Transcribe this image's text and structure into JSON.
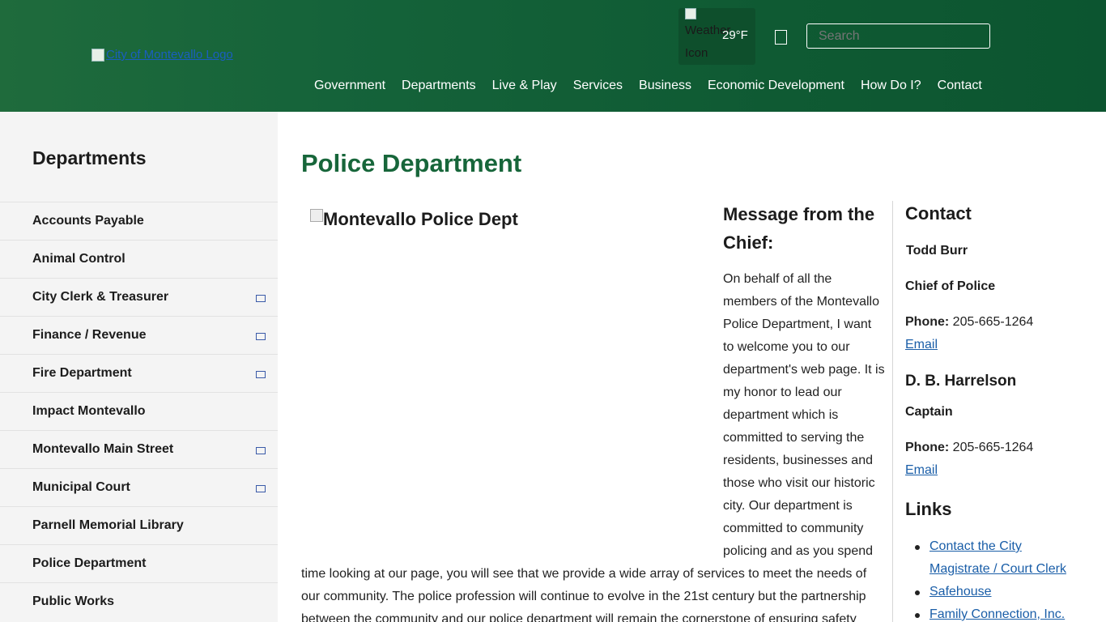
{
  "header": {
    "logo_alt": "City of Montevallo Logo",
    "weather_icon_alt": "Weather Icon",
    "temperature": "29°F",
    "search_placeholder": "Search"
  },
  "nav": [
    "Government",
    "Departments",
    "Live & Play",
    "Services",
    "Business",
    "Economic Development",
    "How Do I?",
    "Contact"
  ],
  "sidebar": {
    "title": "Departments",
    "items": [
      {
        "label": "Accounts Payable",
        "expandable": false
      },
      {
        "label": "Animal Control",
        "expandable": false
      },
      {
        "label": "City Clerk & Treasurer",
        "expandable": true
      },
      {
        "label": "Finance / Revenue",
        "expandable": true
      },
      {
        "label": "Fire Department",
        "expandable": true
      },
      {
        "label": "Impact Montevallo",
        "expandable": false
      },
      {
        "label": "Montevallo Main Street",
        "expandable": true
      },
      {
        "label": "Municipal Court",
        "expandable": true
      },
      {
        "label": "Parnell Memorial Library",
        "expandable": false
      },
      {
        "label": "Police Department",
        "expandable": false
      },
      {
        "label": "Public Works",
        "expandable": false
      }
    ]
  },
  "main": {
    "title": "Police Department",
    "hero_alt": "Montevallo Police Dept",
    "message_title": "Message from the Chief:",
    "message_body": "On behalf of all the members of the Montevallo Police Department, I want to welcome you to our department's web page. It is my honor to lead our department which is committed to serving the residents, businesses and those who visit our historic city. Our department is committed to community policing and as you spend",
    "message_continued": "time looking at our page, you will see that we provide a wide array of services to meet the needs of our community. The police profession will continue to evolve in the 21st century but the partnership between the community and our police department will remain the cornerstone of ensuring safety"
  },
  "contact": {
    "title": "Contact",
    "person1_name": "Todd Burr",
    "person1_role": "Chief of Police",
    "person1_phone_label": "Phone:",
    "person1_phone": "205-665-1264",
    "person1_email": "Email",
    "person2_name": "D. B. Harrelson",
    "person2_role": "Captain",
    "person2_phone_label": "Phone:",
    "person2_phone": "205-665-1264",
    "person2_email": "Email",
    "links_title": "Links",
    "links": [
      "Contact the City Magistrate / Court Clerk",
      "Safehouse",
      "Family Connection, Inc."
    ]
  },
  "colors": {
    "header_green": "#15633a",
    "title_green": "#17663a",
    "link_blue": "#1a5ea8"
  }
}
